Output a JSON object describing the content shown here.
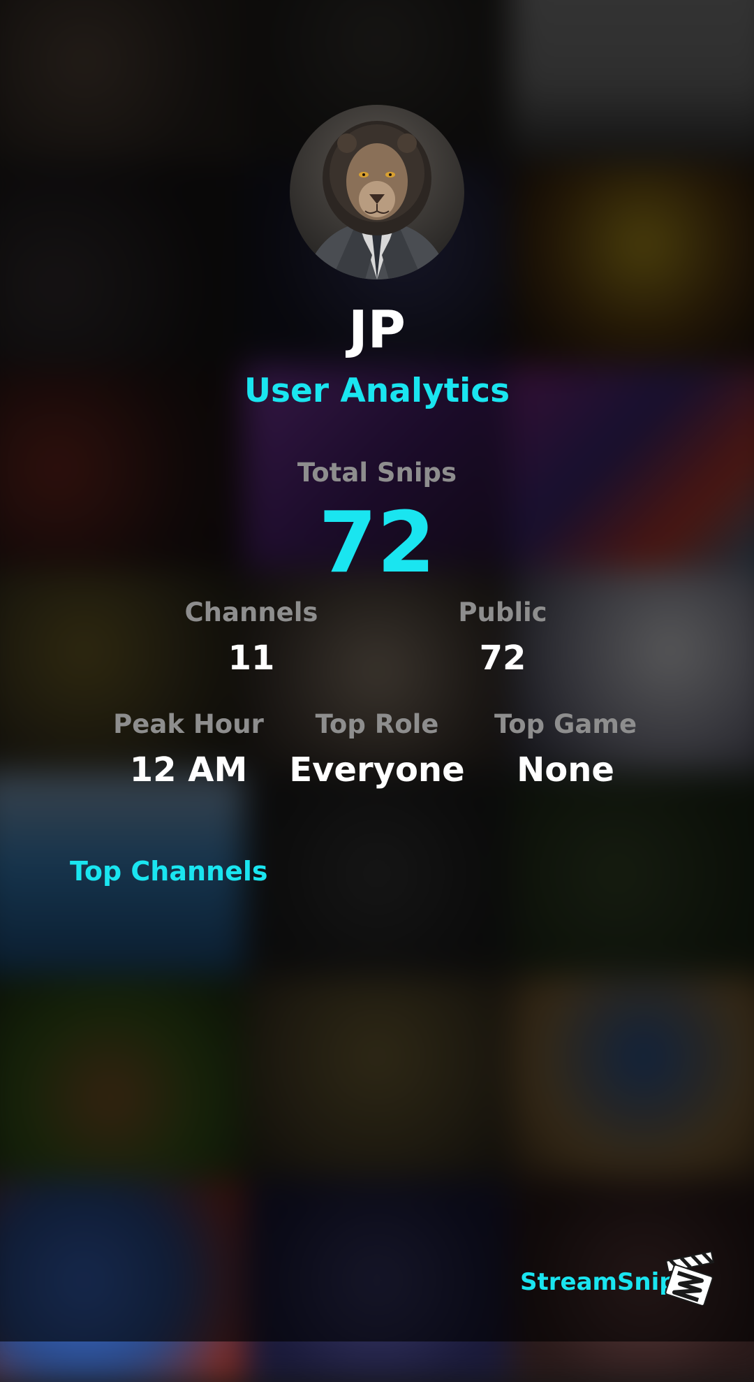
{
  "profile": {
    "username": "JP",
    "subtitle": "User Analytics"
  },
  "stats": {
    "total_snips": {
      "label": "Total Snips",
      "value": "72"
    },
    "channels": {
      "label": "Channels",
      "value": "11"
    },
    "public": {
      "label": "Public",
      "value": "72"
    },
    "peak_hour": {
      "label": "Peak Hour",
      "value": "12 AM"
    },
    "top_role": {
      "label": "Top Role",
      "value": "Everyone"
    },
    "top_game": {
      "label": "Top Game",
      "value": "None"
    }
  },
  "sections": {
    "top_channels_title": "Top Channels"
  },
  "brand": {
    "name": "StreamSnip",
    "logo_icon": "clapperboard-icon"
  },
  "colors": {
    "accent": "#1ae5f0",
    "label_gray": "#8e8e8e",
    "text_white": "#ffffff"
  }
}
